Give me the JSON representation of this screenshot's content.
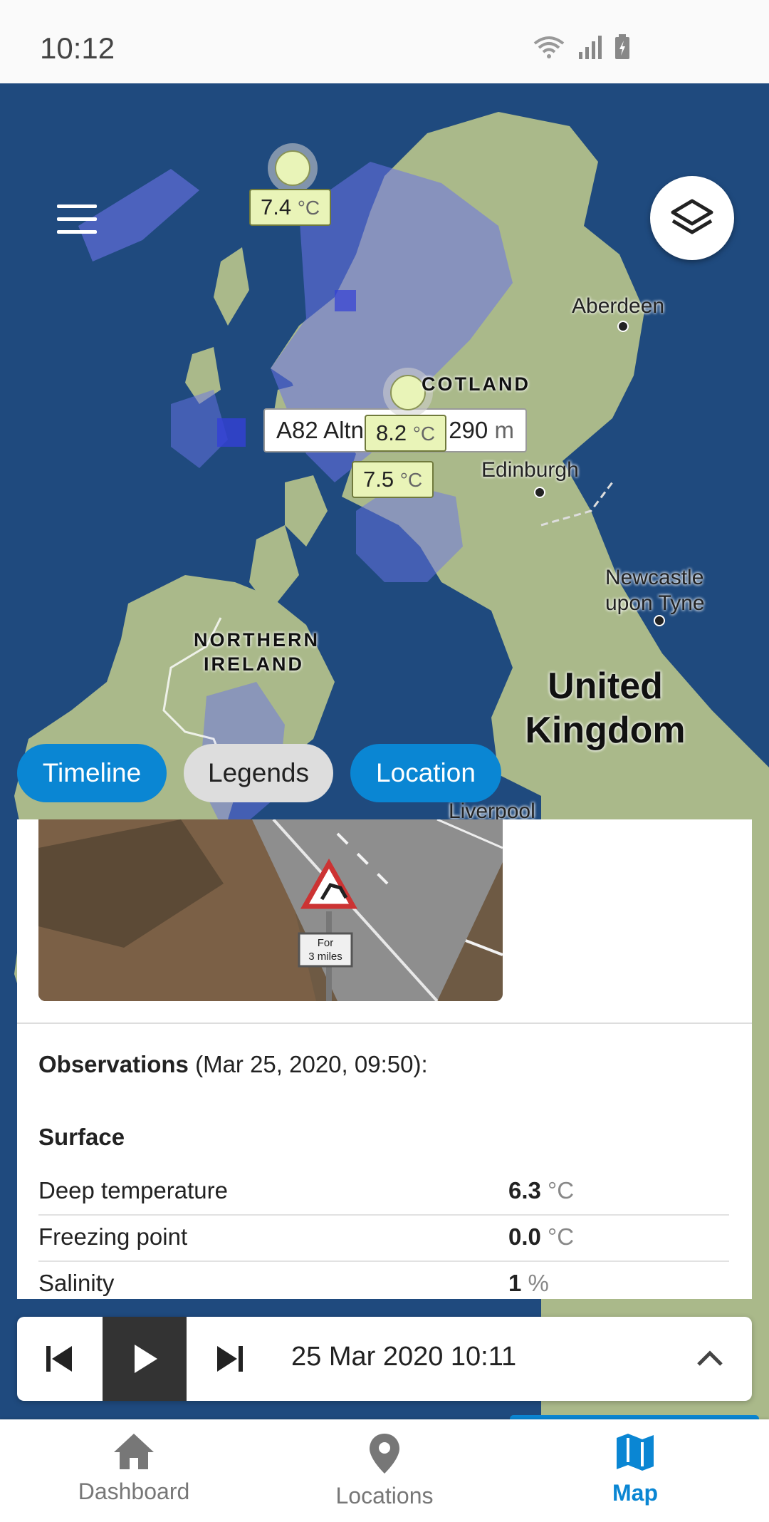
{
  "status_bar": {
    "time": "10:12"
  },
  "map": {
    "markers": [
      {
        "temp": "7.4",
        "unit": "°C"
      },
      {
        "temp": "8.2",
        "unit": "°C"
      },
      {
        "temp": "7.5",
        "unit": "°C"
      }
    ],
    "selected_location": {
      "name": "A82 Altnafeadh, 290",
      "unit": "m"
    },
    "cities": [
      "Aberdeen",
      "Edinburgh",
      "Newcastle upon Tyne",
      "Liverpool"
    ],
    "regions": [
      "COTLAND",
      "NORTHERN",
      "IRELAND"
    ],
    "country": "United Kingdom"
  },
  "tabs": {
    "timeline": "Timeline",
    "legends": "Legends",
    "location": "Location"
  },
  "panel": {
    "photo_sign": "For 3 miles",
    "observations_label": "Observations",
    "observations_time": " (Mar 25, 2020, 09:50):",
    "section": "Surface",
    "rows": [
      {
        "label": "Deep temperature",
        "value": "6.3",
        "unit": "°C"
      },
      {
        "label": "Freezing point",
        "value": "0.0",
        "unit": "°C"
      },
      {
        "label": "Salinity",
        "value": "1",
        "unit": "%"
      }
    ]
  },
  "player": {
    "datetime": "25 Mar 2020 10:11"
  },
  "nav": {
    "dashboard": "Dashboard",
    "locations": "Locations",
    "map": "Map"
  },
  "colors": {
    "accent": "#0a86d3",
    "sea": "#1f4a7e",
    "land": "#aab98a",
    "rain": "#6a73e8"
  }
}
